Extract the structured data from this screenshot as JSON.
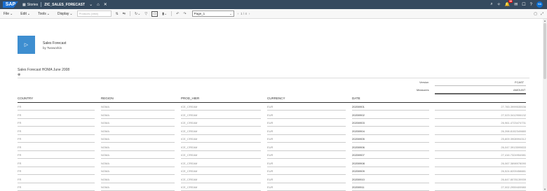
{
  "shell": {
    "logo": "SAP",
    "app": "Stories",
    "title": "ZIC_SALES_FORECAST",
    "notifications_count": "99",
    "avatar_initials": "MA"
  },
  "toolbar": {
    "menus": [
      "File",
      "Edit",
      "Tools",
      "Display"
    ],
    "search_placeholder": "Products (view)",
    "page_selected": "Page_1",
    "page_counter": "1 / 4"
  },
  "story": {
    "name": "Sales Forecast",
    "author": "by Twoworkin"
  },
  "table": {
    "title": "Sales Forecast HOMA June 2008",
    "version_label": "Version",
    "version_value": "FCAST",
    "measures_label": "Measures",
    "measures_value": "AMOUNT",
    "columns": [
      "COUNTRY",
      "REGION",
      "PROD_HIER",
      "CURRENCY",
      "DATE"
    ],
    "rows": [
      {
        "country": "FR",
        "region": "NOMA",
        "prod": "ICE_CREAM",
        "curr": "EUR",
        "date": "20200901",
        "amount": "27,783.3999535536"
      },
      {
        "country": "FR",
        "region": "NOMA",
        "prod": "ICE_CREAM",
        "curr": "EUR",
        "date": "20200902",
        "amount": "27,023.3412906132"
      },
      {
        "country": "FR",
        "region": "NOMA",
        "prod": "ICE_CREAM",
        "curr": "EUR",
        "date": "20200903",
        "amount": "26,961.4723474731"
      },
      {
        "country": "FR",
        "region": "NOMA",
        "prod": "ICE_CREAM",
        "curr": "EUR",
        "date": "20200904",
        "amount": "26,398.8152349880"
      },
      {
        "country": "FR",
        "region": "NOMA",
        "prod": "ICE_CREAM",
        "curr": "EUR",
        "date": "20200905",
        "amount": "25,809.3908994312"
      },
      {
        "country": "FR",
        "region": "NOMA",
        "prod": "ICE_CREAM",
        "curr": "EUR",
        "date": "20200906",
        "amount": "26,047.3913599833"
      },
      {
        "country": "FR",
        "region": "NOMA",
        "prod": "ICE_CREAM",
        "curr": "EUR",
        "date": "20200907",
        "amount": "27,416.7324954981"
      },
      {
        "country": "FR",
        "region": "NOMA",
        "prod": "ICE_CREAM",
        "curr": "EUR",
        "date": "20200908",
        "amount": "26,067.3898978090"
      },
      {
        "country": "FR",
        "region": "NOMA",
        "prod": "ICE_CREAM",
        "curr": "EUR",
        "date": "20200909",
        "amount": "26,524.8209458881"
      },
      {
        "country": "FR",
        "region": "NOMA",
        "prod": "ICE_CREAM",
        "curr": "EUR",
        "date": "20200910",
        "amount": "26,647.8078139939"
      },
      {
        "country": "FR",
        "region": "NOMA",
        "prod": "ICE_CREAM",
        "curr": "EUR",
        "date": "20200911",
        "amount": "27,002.2959409980"
      }
    ]
  },
  "colors": {
    "shell_bg": "#354a5f",
    "accent": "#3e8ed0",
    "badge": "#e00000"
  }
}
